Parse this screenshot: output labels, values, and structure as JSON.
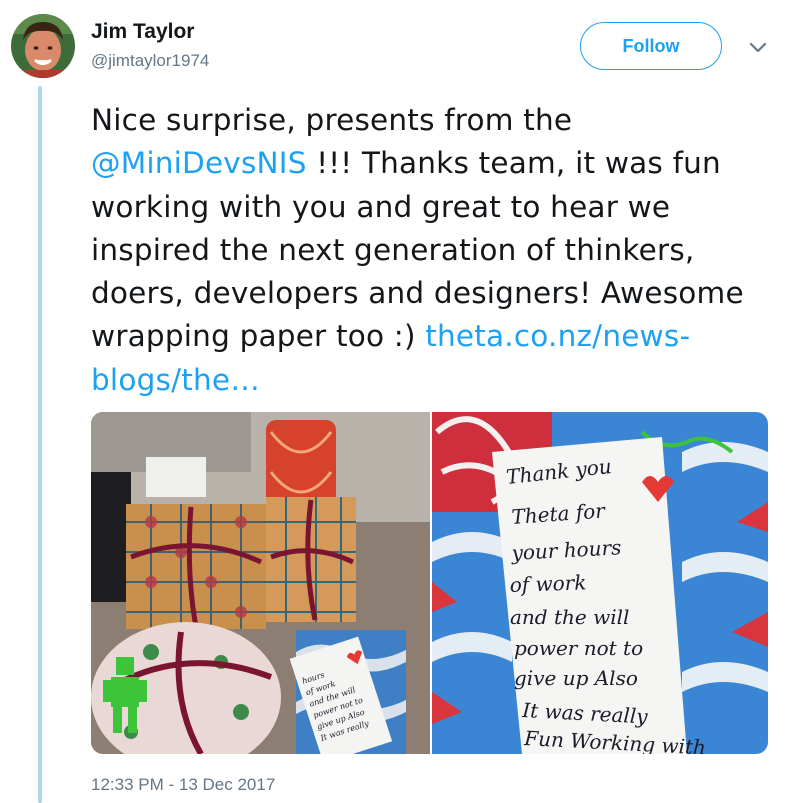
{
  "author": {
    "name": "Jim Taylor",
    "handle": "@jimtaylor1974"
  },
  "follow_label": "Follow",
  "tweet": {
    "text_1": "Nice surprise, presents from the",
    "mention": "@MiniDevsNIS",
    "text_2": " !!! Thanks team, it was fun working with you and great to hear we inspired the next generation of thinkers, doers, developers and designers! Awesome wrapping paper too :) ",
    "link": "theta.co.nz/news-blogs/the…"
  },
  "card_note": {
    "lines": [
      "Thank you",
      "Theta  for",
      "your hours",
      "of work",
      "and the will",
      "power not to",
      "give up Also",
      "It was really",
      "Fun Working with"
    ]
  },
  "timestamp": "12:33 PM - 13 Dec 2017",
  "colors": {
    "accent": "#1da1f2",
    "secondary_text": "#657786",
    "thread_line": "#aed4f0"
  }
}
